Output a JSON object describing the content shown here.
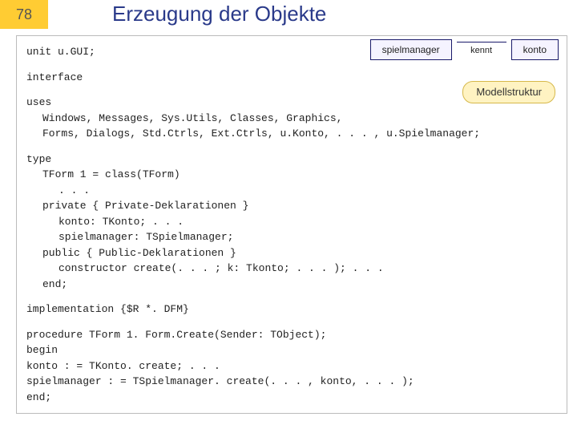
{
  "slide": {
    "number": "78",
    "title": "Erzeugung der Objekte"
  },
  "diagram": {
    "left_box": "spielmanager",
    "connector": "kennt",
    "right_box": "konto"
  },
  "badge": "Modellstruktur",
  "code": {
    "l1": "unit u.GUI;",
    "l2": "interface",
    "l3": "uses",
    "l3a": "Windows, Messages, Sys.Utils, Classes, Graphics,",
    "l3b": "Forms, Dialogs, Std.Ctrls, Ext.Ctrls, u.Konto, . . . , u.Spielmanager;",
    "l4": "type",
    "l4a": "TForm 1 = class(TForm)",
    "l4b": ". . .",
    "l4c": "private    { Private-Deklarationen }",
    "l4c1": "konto: TKonto; . . .",
    "l4c2": "spielmanager: TSpielmanager;",
    "l4d": "public     { Public-Deklarationen }",
    "l4d1": "constructor create(. . . ; k: Tkonto; . . . ); . . .",
    "l4e": "end;",
    "l5": "implementation {$R *. DFM}",
    "l6": "procedure TForm 1. Form.Create(Sender: TObject);",
    "l6a": "begin",
    "l6b": "konto : = TKonto. create; . . .",
    "l6c": "spielmanager : = TSpielmanager. create(. . . , konto, . . . );",
    "l6d": "end;"
  }
}
